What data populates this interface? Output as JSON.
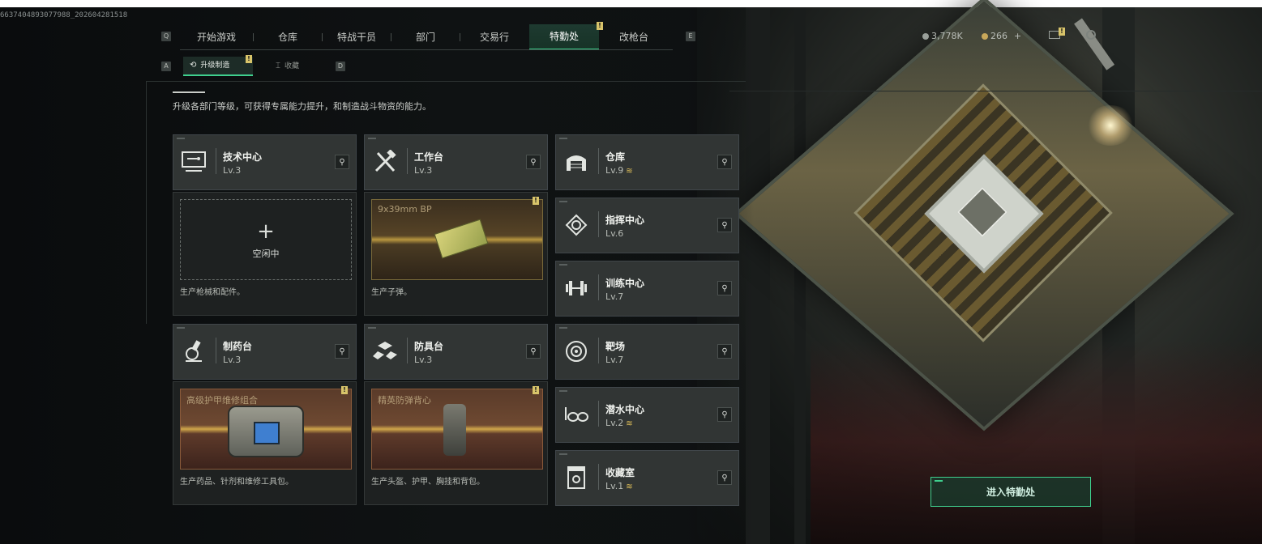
{
  "watermark": "6637404893077988_202604281518",
  "nav": {
    "left_key": "Q",
    "right_key": "E",
    "tabs": [
      {
        "label": "开始游戏",
        "active": false,
        "badge": ""
      },
      {
        "label": "仓库",
        "active": false,
        "badge": ""
      },
      {
        "label": "特战干员",
        "active": false,
        "badge": ""
      },
      {
        "label": "部门",
        "active": false,
        "badge": ""
      },
      {
        "label": "交易行",
        "active": false,
        "badge": ""
      },
      {
        "label": "特勤处",
        "active": true,
        "badge": "!"
      },
      {
        "label": "改枪台",
        "active": false,
        "badge": ""
      }
    ]
  },
  "resources": {
    "currency1": "3,778K",
    "currency2": "266",
    "currency2_plus": "+",
    "mail_badge": "!"
  },
  "subnav": {
    "left_key": "A",
    "right_key": "D",
    "tabs": [
      {
        "label": "升级制造",
        "active": true,
        "badge": "!"
      },
      {
        "label": "收藏",
        "active": false
      }
    ]
  },
  "description": "升级各部门等级，可获得专属能力提升，和制造战斗物资的能力。",
  "facilities": {
    "tech_center": {
      "name": "技术中心",
      "level": "Lv.3",
      "icon": "computer-icon"
    },
    "workbench": {
      "name": "工作台",
      "level": "Lv.3",
      "icon": "tools-icon"
    },
    "pharmacy": {
      "name": "制药台",
      "level": "Lv.3",
      "icon": "microscope-icon"
    },
    "armor": {
      "name": "防具台",
      "level": "Lv.3",
      "icon": "armor-icon"
    },
    "storage": {
      "name": "仓库",
      "level": "Lv.9",
      "icon": "garage-icon",
      "upgradable": true
    },
    "command": {
      "name": "指挥中心",
      "level": "Lv.6",
      "icon": "chip-icon",
      "upgradable": false
    },
    "training": {
      "name": "训练中心",
      "level": "Lv.7",
      "icon": "dumbbell-icon",
      "upgradable": false
    },
    "range": {
      "name": "靶场",
      "level": "Lv.7",
      "icon": "target-icon",
      "upgradable": false
    },
    "diving": {
      "name": "潜水中心",
      "level": "Lv.2",
      "icon": "goggles-icon",
      "upgradable": true
    },
    "collection": {
      "name": "收藏室",
      "level": "Lv.1",
      "icon": "vault-icon",
      "upgradable": true
    }
  },
  "production": {
    "tech_center": {
      "status": "空闲中",
      "caption": "生产枪械和配件。"
    },
    "workbench": {
      "item": "9x39mm BP",
      "caption": "生产子弹。",
      "badge": "!"
    },
    "pharmacy": {
      "item": "高级护甲维修组合",
      "caption": "生产药品、针剂和维修工具包。",
      "badge": "!"
    },
    "armor": {
      "item": "精英防弹背心",
      "caption": "生产头盔、护甲、胸挂和背包。",
      "badge": "!"
    }
  },
  "upgrade_symbol": "≋",
  "cta_label": "进入特勤处",
  "colors": {
    "accent": "#3fd08e",
    "badge": "#d8c46a",
    "upgrade": "#e0c05a"
  }
}
